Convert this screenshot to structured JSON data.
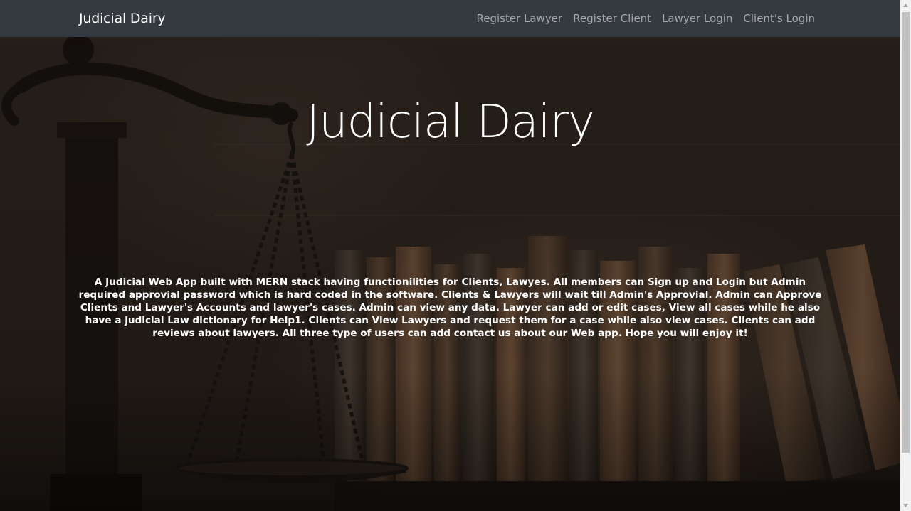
{
  "navbar": {
    "brand": "Judicial Dairy",
    "links": [
      {
        "label": "Register Lawyer"
      },
      {
        "label": "Register Client"
      },
      {
        "label": "Lawyer Login"
      },
      {
        "label": "Client's Login"
      }
    ]
  },
  "hero": {
    "title": "Judicial Dairy",
    "description": "A Judicial Web App built with MERN stack having functionilities for Clients, Lawyes. All members can Sign up and Login but Admin required approvial password which is hard coded in the software. Clients & Lawyers will wait till Admin's Approvial. Admin can Approve Clients and Lawyer's Accounts and lawyer's cases. Admin can view any data. Lawyer can add or edit cases, View all cases while he also have a judicial Law dictionary for Help1. Clients can View Lawyers and request them for a case while also view cases. Clients can add reviews about lawyers. All three type of users can add contact us about our Web app. Hope you will enjoy it!"
  },
  "colors": {
    "navbar_bg": "#343a40",
    "brand_text": "#ffffff",
    "nav_link_text": "#a5a8ab",
    "hero_text": "#ffffff"
  },
  "icons": {
    "scroll_up": "triangle-up-icon",
    "scroll_down": "triangle-down-icon"
  }
}
